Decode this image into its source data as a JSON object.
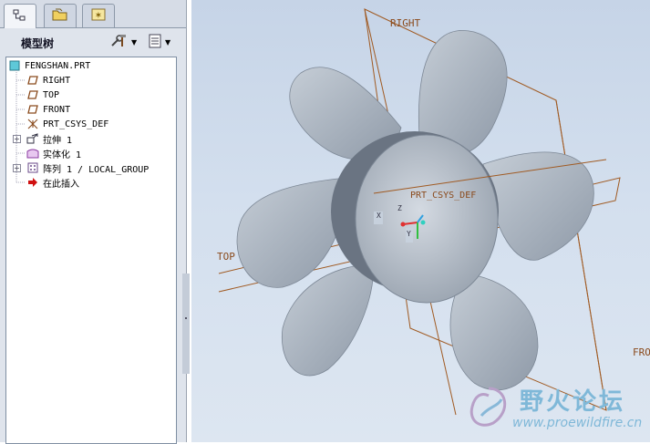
{
  "panel": {
    "title": "模型树",
    "tabs": [
      {
        "name": "model-tree-tab",
        "icon": "tree-icon",
        "active": true
      },
      {
        "name": "folder-browser-tab",
        "icon": "folder-icon",
        "active": false
      },
      {
        "name": "favorites-tab",
        "icon": "star-icon",
        "active": false
      }
    ],
    "settings_icon": "tools-icon",
    "show_icon": "list-icon"
  },
  "tree": {
    "root": "FENGSHAN.PRT",
    "items": [
      {
        "label": "RIGHT",
        "icon": "datum-plane-icon",
        "expandable": false
      },
      {
        "label": "TOP",
        "icon": "datum-plane-icon",
        "expandable": false
      },
      {
        "label": "FRONT",
        "icon": "datum-plane-icon",
        "expandable": false
      },
      {
        "label": "PRT_CSYS_DEF",
        "icon": "coordinate-system-icon",
        "expandable": false
      },
      {
        "label": "拉伸 1",
        "icon": "extrude-icon",
        "expandable": true
      },
      {
        "label": "实体化 1",
        "icon": "solidify-icon",
        "expandable": false
      },
      {
        "label": "阵列 1 / LOCAL_GROUP",
        "icon": "pattern-icon",
        "expandable": true
      },
      {
        "label": "在此插入",
        "icon": "insert-here-arrow-icon",
        "expandable": false
      }
    ]
  },
  "viewport": {
    "labels": {
      "right": "RIGHT",
      "top": "TOP",
      "front": "FRO",
      "csys": "PRT_CSYS_DEF",
      "x_axis": "X",
      "y_axis": "Y",
      "z_axis": "Z"
    }
  },
  "watermark": {
    "cn": "野火论坛",
    "url": "www.proewildfire.cn"
  },
  "colors": {
    "datum": "#a05a22",
    "background_top": "#c6d4e7",
    "blade": "#a9b3bf"
  }
}
